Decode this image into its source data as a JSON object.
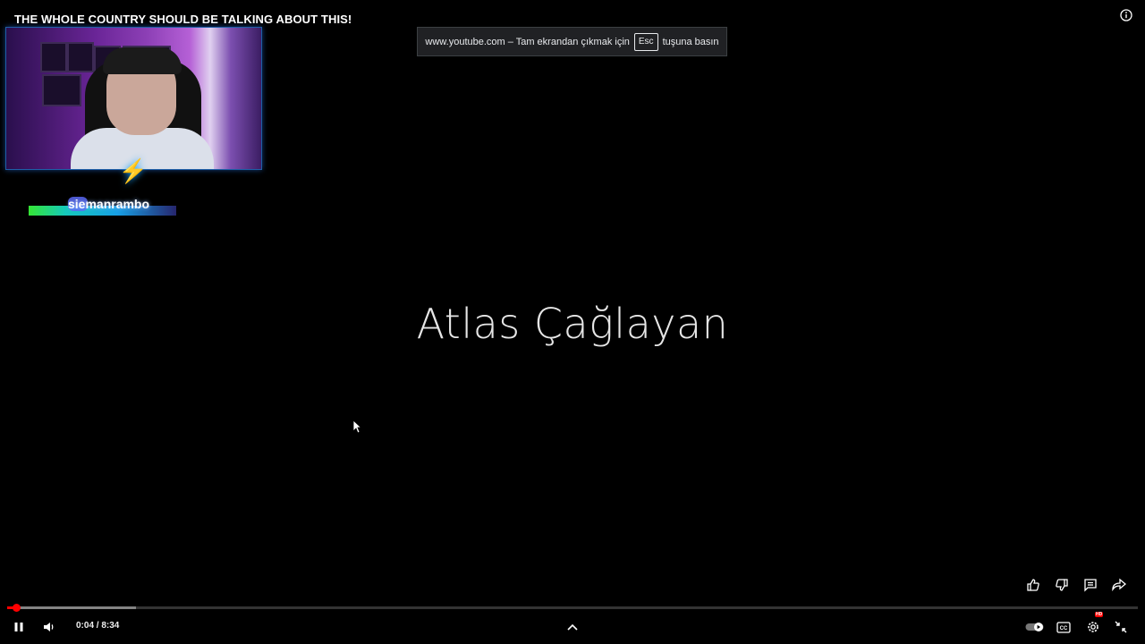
{
  "video": {
    "title": "THE WHOLE COUNTRY SHOULD BE TALKING ABOUT THIS!",
    "center_text": "Atlas Çağlayan",
    "streamer_name": "siemanrambo"
  },
  "fullscreen_banner": {
    "text_before": "www.youtube.com – Tam ekrandan çıkmak için",
    "key": "Esc",
    "text_after": "tuşuna basın"
  },
  "player": {
    "time_display": "0:04 / 8:34",
    "progress_fraction": 0.0078,
    "buffer_fraction": 0.114,
    "quality_badge": "HD",
    "accent_color": "#ff0000"
  },
  "icons": {
    "info": "info-icon",
    "like": "thumbs-up-icon",
    "dislike": "thumbs-down-icon",
    "comments": "comments-icon",
    "share": "share-icon",
    "pause": "pause-icon",
    "volume": "volume-icon",
    "chevron": "chevron-up-icon",
    "autoplay": "autoplay-toggle-icon",
    "captions": "captions-icon",
    "settings": "settings-icon",
    "exit_fullscreen": "exit-fullscreen-icon"
  }
}
